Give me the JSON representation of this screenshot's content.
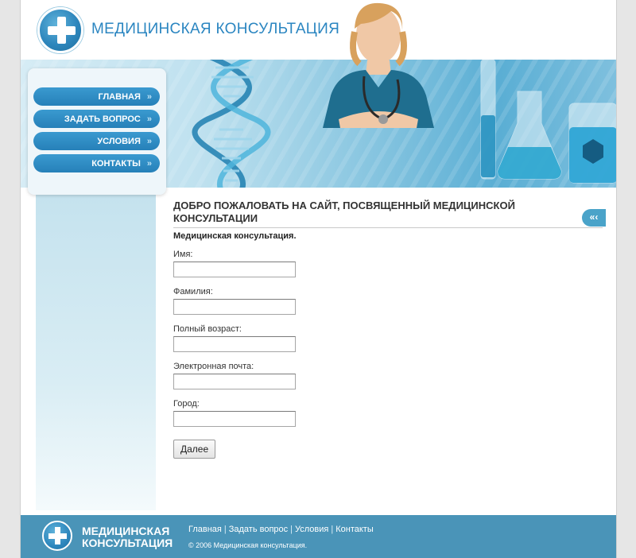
{
  "header": {
    "site_title": "МЕДИЦИНСКАЯ КОНСУЛЬТАЦИЯ"
  },
  "nav": {
    "items": [
      {
        "label": "ГЛАВНАЯ",
        "chevron": "»"
      },
      {
        "label": "ЗАДАТЬ ВОПРОС",
        "chevron": "»"
      },
      {
        "label": "УСЛОВИЯ",
        "chevron": "»"
      },
      {
        "label": "КОНТАКТЫ",
        "chevron": "»"
      }
    ]
  },
  "content": {
    "heading": "ДОБРО ПОЖАЛОВАТЬ НА САЙТ, ПОСВЯЩЕННЫЙ МЕДИЦИНСКОЙ КОНСУЛЬТАЦИИ",
    "subheading": "Медицинская консультация.",
    "back_tab_label": "«‹",
    "form": {
      "fields": [
        {
          "label": "Имя:",
          "value": ""
        },
        {
          "label": "Фамилия:",
          "value": ""
        },
        {
          "label": "Полный возраст:",
          "value": ""
        },
        {
          "label": "Электронная почта:",
          "value": ""
        },
        {
          "label": "Город:",
          "value": ""
        }
      ],
      "submit_label": "Далее"
    }
  },
  "footer": {
    "title_line1": "МЕДИЦИНСКАЯ",
    "title_line2": "КОНСУЛЬТАЦИЯ",
    "links": [
      "Главная",
      "Задать вопрос",
      "Условия",
      "Контакты"
    ],
    "separator": "|",
    "copyright": "© 2006 Медицинская консультация."
  },
  "colors": {
    "accent": "#2b86c1",
    "nav_button": "#2680b9",
    "footer_bg": "#4a94b8"
  },
  "icons": [
    "medical-cross-logo-icon",
    "double-chevron-right-icon",
    "double-chevron-left-icon"
  ]
}
